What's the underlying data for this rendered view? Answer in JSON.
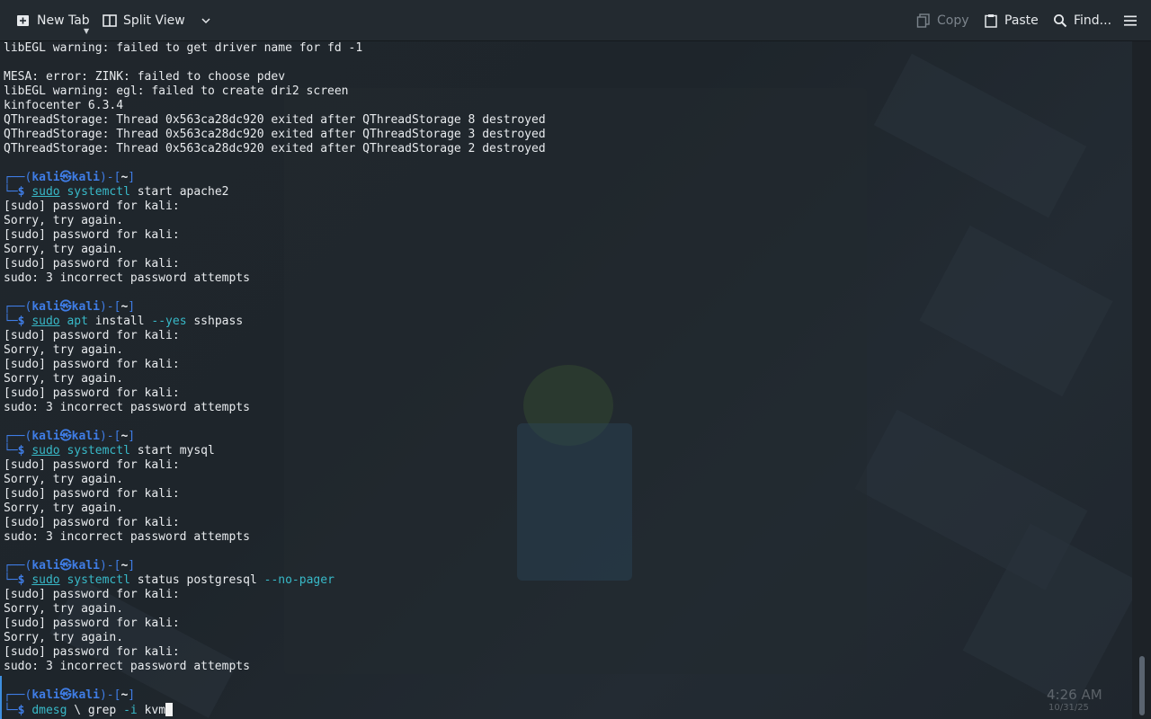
{
  "toolbar": {
    "new_tab": "New Tab",
    "split_view": "Split View",
    "copy": "Copy",
    "paste": "Paste",
    "find": "Find..."
  },
  "terminal": {
    "prompt_user": "kali",
    "prompt_host": "kali",
    "prompt_dir": "~",
    "preamble": [
      "libEGL warning: failed to get driver name for fd -1",
      "",
      "MESA: error: ZINK: failed to choose pdev",
      "libEGL warning: egl: failed to create dri2 screen",
      "kinfocenter 6.3.4",
      "QThreadStorage: Thread 0x563ca28dc920 exited after QThreadStorage 8 destroyed",
      "QThreadStorage: Thread 0x563ca28dc920 exited after QThreadStorage 3 destroyed",
      "QThreadStorage: Thread 0x563ca28dc920 exited after QThreadStorage 2 destroyed"
    ],
    "blocks": [
      {
        "cmd": "sudo",
        "rest": [
          {
            "t": "systemctl",
            "c": "cyan"
          },
          {
            "t": " start apache2",
            "c": ""
          }
        ],
        "output": [
          "[sudo] password for kali:",
          "Sorry, try again.",
          "[sudo] password for kali:",
          "Sorry, try again.",
          "[sudo] password for kali:",
          "sudo: 3 incorrect password attempts"
        ]
      },
      {
        "cmd": "sudo",
        "rest": [
          {
            "t": "apt",
            "c": "cyan"
          },
          {
            "t": " install ",
            "c": ""
          },
          {
            "t": "--yes",
            "c": "cyan"
          },
          {
            "t": " sshpass",
            "c": ""
          }
        ],
        "output": [
          "[sudo] password for kali:",
          "Sorry, try again.",
          "[sudo] password for kali:",
          "Sorry, try again.",
          "[sudo] password for kali:",
          "sudo: 3 incorrect password attempts"
        ]
      },
      {
        "cmd": "sudo",
        "rest": [
          {
            "t": "systemctl",
            "c": "cyan"
          },
          {
            "t": " start mysql",
            "c": ""
          }
        ],
        "output": [
          "[sudo] password for kali:",
          "Sorry, try again.",
          "[sudo] password for kali:",
          "Sorry, try again.",
          "[sudo] password for kali:",
          "sudo: 3 incorrect password attempts"
        ]
      },
      {
        "cmd": "sudo",
        "rest": [
          {
            "t": "systemctl",
            "c": "cyan"
          },
          {
            "t": " status postgresql ",
            "c": ""
          },
          {
            "t": "--no-pager",
            "c": "cyan"
          }
        ],
        "output": [
          "[sudo] password for kali:",
          "Sorry, try again.",
          "[sudo] password for kali:",
          "Sorry, try again.",
          "[sudo] password for kali:",
          "sudo: 3 incorrect password attempts"
        ]
      }
    ],
    "current_input": [
      {
        "t": "dmesg",
        "c": "cyan"
      },
      {
        "t": " \\ grep ",
        "c": ""
      },
      {
        "t": "-i",
        "c": "cyan"
      },
      {
        "t": " kvm",
        "c": ""
      }
    ]
  },
  "tray": {
    "time": "4:26 AM",
    "date": "10/31/25"
  },
  "colors": {
    "prompt_frame": "#3f7de6",
    "prompt_dollar": "#2ed058",
    "command": "#38b9c8"
  }
}
